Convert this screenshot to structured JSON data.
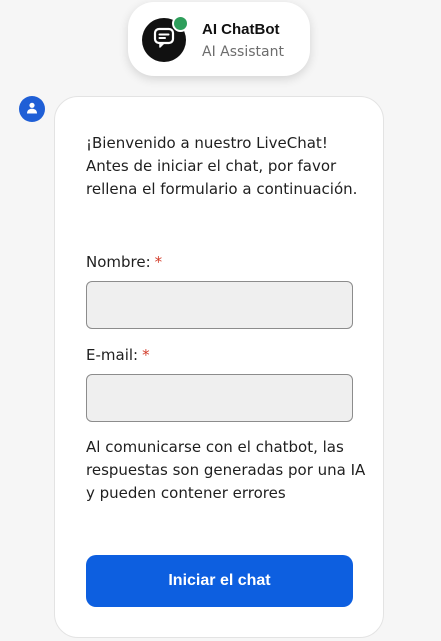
{
  "agent": {
    "name": "AI ChatBot",
    "role": "AI Assistant",
    "status_color": "#2e9e5b",
    "avatar_icon": "chat-bubble-icon"
  },
  "message_avatar_icon": "user-icon",
  "form": {
    "welcome_text": "¡Bienvenido a nuestro LiveChat! Antes de iniciar el chat, por favor rellena el formulario a continuación.",
    "name_label": "Nombre:",
    "email_label": "E-mail:",
    "required_mark": "*",
    "name_value": "",
    "email_value": "",
    "disclaimer": "Al comunicarse con el chatbot, las respuestas son generadas por una IA y pueden contener errores",
    "submit_label": "Iniciar el chat"
  },
  "colors": {
    "accent": "#0d5fe0",
    "required": "#d23c2a",
    "online": "#2e9e5b"
  }
}
